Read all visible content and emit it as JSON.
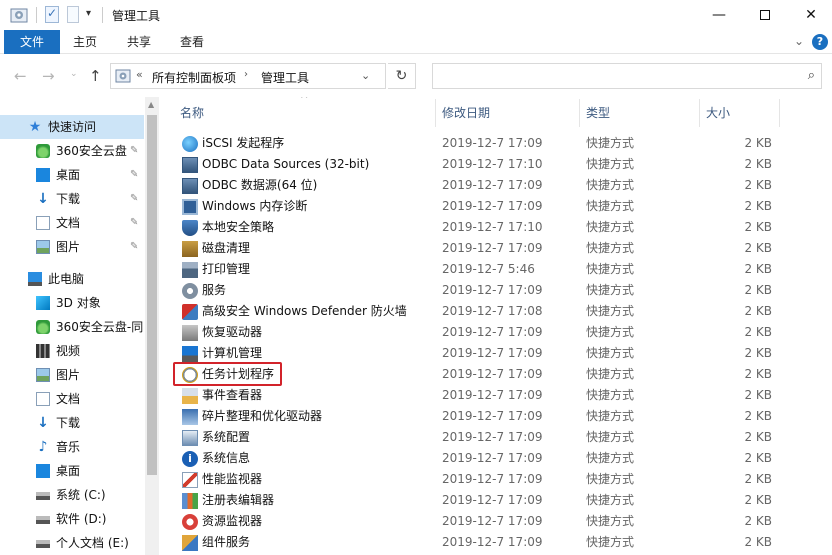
{
  "window": {
    "title": "管理工具",
    "controls": {
      "minimize": "—",
      "close": "✕"
    }
  },
  "ribbon": {
    "tabs": [
      "文件",
      "主页",
      "共享",
      "查看"
    ],
    "collapse_glyph": "⌄",
    "help_glyph": "?"
  },
  "address": {
    "sep": "«",
    "segments": [
      "所有控制面板项",
      "管理工具"
    ],
    "arrow": "›",
    "dropdown": "⌄",
    "refresh": "↻",
    "search_placeholder": ""
  },
  "nav": {
    "back": "←",
    "forward": "→",
    "recent": "⌄",
    "up": "↑"
  },
  "sidebar": {
    "items": [
      {
        "label": "快速访问",
        "icon": "star-icon",
        "cls": "s-star",
        "glyph": "★",
        "indent": 30,
        "selected": true,
        "pin": false
      },
      {
        "label": "360安全云盘",
        "icon": "cloud-drive-icon",
        "cls": "s-cloud",
        "glyph": "",
        "indent": 38,
        "selected": false,
        "pin": true
      },
      {
        "label": "桌面",
        "icon": "desktop-icon",
        "cls": "s-desk",
        "glyph": "",
        "indent": 38,
        "selected": false,
        "pin": true
      },
      {
        "label": "下载",
        "icon": "download-icon",
        "cls": "s-down",
        "glyph": "↓",
        "indent": 38,
        "selected": false,
        "pin": true
      },
      {
        "label": "文档",
        "icon": "documents-icon",
        "cls": "s-docs",
        "glyph": "",
        "indent": 38,
        "selected": false,
        "pin": true
      },
      {
        "label": "图片",
        "icon": "pictures-icon",
        "cls": "s-pics",
        "glyph": "",
        "indent": 38,
        "selected": false,
        "pin": true
      },
      {
        "label": "此电脑",
        "icon": "this-pc-icon",
        "cls": "s-pc",
        "glyph": "",
        "indent": 30,
        "selected": false,
        "pin": false
      },
      {
        "label": "3D 对象",
        "icon": "3d-objects-icon",
        "cls": "s-3d",
        "glyph": "",
        "indent": 38,
        "selected": false,
        "pin": false
      },
      {
        "label": "360安全云盘-同",
        "icon": "cloud-drive-icon",
        "cls": "s-cloud",
        "glyph": "",
        "indent": 38,
        "selected": false,
        "pin": false
      },
      {
        "label": "视频",
        "icon": "videos-icon",
        "cls": "s-video",
        "glyph": "",
        "indent": 38,
        "selected": false,
        "pin": false
      },
      {
        "label": "图片",
        "icon": "pictures-icon",
        "cls": "s-pics",
        "glyph": "",
        "indent": 38,
        "selected": false,
        "pin": false
      },
      {
        "label": "文档",
        "icon": "documents-icon",
        "cls": "s-docs",
        "glyph": "",
        "indent": 38,
        "selected": false,
        "pin": false
      },
      {
        "label": "下载",
        "icon": "download-icon",
        "cls": "s-down",
        "glyph": "↓",
        "indent": 38,
        "selected": false,
        "pin": false
      },
      {
        "label": "音乐",
        "icon": "music-icon",
        "cls": "s-music",
        "glyph": "♪",
        "indent": 38,
        "selected": false,
        "pin": false
      },
      {
        "label": "桌面",
        "icon": "desktop-icon",
        "cls": "s-desk",
        "glyph": "",
        "indent": 38,
        "selected": false,
        "pin": false
      },
      {
        "label": "系统 (C:)",
        "icon": "drive-icon",
        "cls": "s-drive",
        "glyph": "",
        "indent": 38,
        "selected": false,
        "pin": false
      },
      {
        "label": "软件 (D:)",
        "icon": "drive-icon",
        "cls": "s-drive",
        "glyph": "",
        "indent": 38,
        "selected": false,
        "pin": false
      },
      {
        "label": "个人文档 (E:)",
        "icon": "drive-icon",
        "cls": "s-drive",
        "glyph": "",
        "indent": 38,
        "selected": false,
        "pin": false
      }
    ],
    "pin_glyph": "📌"
  },
  "columns": {
    "name": "名称",
    "date": "修改日期",
    "type": "类型",
    "size": "大小",
    "sort_glyph": "^"
  },
  "files": [
    {
      "name": "iSCSI 发起程序",
      "date": "2019-12-7 17:09",
      "type": "快捷方式",
      "size": "2 KB",
      "icon": "iscsi-icon",
      "cls": "i-globe"
    },
    {
      "name": "ODBC Data Sources (32-bit)",
      "date": "2019-12-7 17:10",
      "type": "快捷方式",
      "size": "2 KB",
      "icon": "odbc-icon",
      "cls": "i-db"
    },
    {
      "name": "ODBC 数据源(64 位)",
      "date": "2019-12-7 17:09",
      "type": "快捷方式",
      "size": "2 KB",
      "icon": "odbc-icon",
      "cls": "i-db"
    },
    {
      "name": "Windows 内存诊断",
      "date": "2019-12-7 17:09",
      "type": "快捷方式",
      "size": "2 KB",
      "icon": "memory-diagnostic-icon",
      "cls": "i-chip"
    },
    {
      "name": "本地安全策略",
      "date": "2019-12-7 17:10",
      "type": "快捷方式",
      "size": "2 KB",
      "icon": "security-policy-icon",
      "cls": "i-shield"
    },
    {
      "name": "磁盘清理",
      "date": "2019-12-7 17:09",
      "type": "快捷方式",
      "size": "2 KB",
      "icon": "disk-cleanup-icon",
      "cls": "i-disk"
    },
    {
      "name": "打印管理",
      "date": "2019-12-7 5:46",
      "type": "快捷方式",
      "size": "2 KB",
      "icon": "printer-icon",
      "cls": "i-printer"
    },
    {
      "name": "服务",
      "date": "2019-12-7 17:09",
      "type": "快捷方式",
      "size": "2 KB",
      "icon": "services-icon",
      "cls": "i-cog"
    },
    {
      "name": "高级安全 Windows Defender 防火墙",
      "date": "2019-12-7 17:08",
      "type": "快捷方式",
      "size": "2 KB",
      "icon": "firewall-icon",
      "cls": "i-fw"
    },
    {
      "name": "恢复驱动器",
      "date": "2019-12-7 17:09",
      "type": "快捷方式",
      "size": "2 KB",
      "icon": "recovery-drive-icon",
      "cls": "i-drive"
    },
    {
      "name": "计算机管理",
      "date": "2019-12-7 17:09",
      "type": "快捷方式",
      "size": "2 KB",
      "icon": "computer-management-icon",
      "cls": "i-monitor"
    },
    {
      "name": "任务计划程序",
      "date": "2019-12-7 17:09",
      "type": "快捷方式",
      "size": "2 KB",
      "icon": "task-scheduler-icon",
      "cls": "i-clock"
    },
    {
      "name": "事件查看器",
      "date": "2019-12-7 17:09",
      "type": "快捷方式",
      "size": "2 KB",
      "icon": "event-viewer-icon",
      "cls": "i-log"
    },
    {
      "name": "碎片整理和优化驱动器",
      "date": "2019-12-7 17:09",
      "type": "快捷方式",
      "size": "2 KB",
      "icon": "defrag-icon",
      "cls": "i-defrag"
    },
    {
      "name": "系统配置",
      "date": "2019-12-7 17:09",
      "type": "快捷方式",
      "size": "2 KB",
      "icon": "system-config-icon",
      "cls": "i-sysconf"
    },
    {
      "name": "系统信息",
      "date": "2019-12-7 17:09",
      "type": "快捷方式",
      "size": "2 KB",
      "icon": "system-info-icon",
      "cls": "i-info"
    },
    {
      "name": "性能监视器",
      "date": "2019-12-7 17:09",
      "type": "快捷方式",
      "size": "2 KB",
      "icon": "performance-monitor-icon",
      "cls": "i-perf"
    },
    {
      "name": "注册表编辑器",
      "date": "2019-12-7 17:09",
      "type": "快捷方式",
      "size": "2 KB",
      "icon": "registry-editor-icon",
      "cls": "i-reg"
    },
    {
      "name": "资源监视器",
      "date": "2019-12-7 17:09",
      "type": "快捷方式",
      "size": "2 KB",
      "icon": "resource-monitor-icon",
      "cls": "i-resmon"
    },
    {
      "name": "组件服务",
      "date": "2019-12-7 17:09",
      "type": "快捷方式",
      "size": "2 KB",
      "icon": "component-services-icon",
      "cls": "i-comp"
    }
  ],
  "colors": {
    "accent": "#1a6fc0",
    "selection": "#cce4f7",
    "highlight_box": "#d2232a",
    "header_text": "#3d5a80"
  }
}
